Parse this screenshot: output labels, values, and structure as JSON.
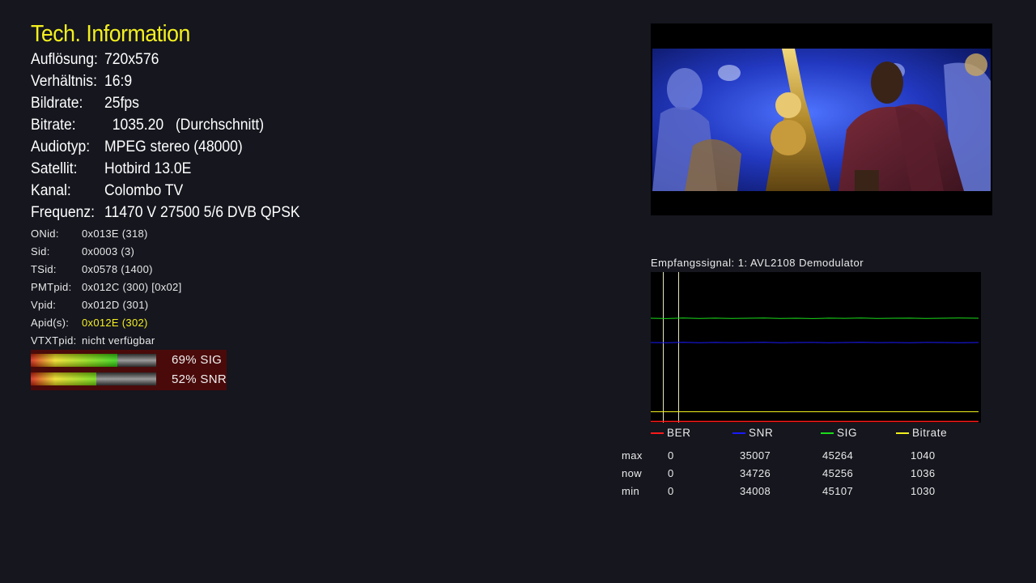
{
  "title": "Tech. Information",
  "info": [
    {
      "label": "Auflösung:",
      "value": "720x576"
    },
    {
      "label": "Verhältnis:",
      "value": "16:9"
    },
    {
      "label": "Bildrate:",
      "value": "25fps"
    },
    {
      "label": "Bitrate:",
      "value": "  1035.20   (Durchschnitt)"
    },
    {
      "label": "Audiotyp:",
      "value": "MPEG stereo (48000)"
    },
    {
      "label": "Satellit:",
      "value": "Hotbird 13.0E"
    },
    {
      "label": "Kanal:",
      "value": "Colombo TV"
    },
    {
      "label": "Frequenz:",
      "value": "11470 V 27500 5/6 DVB QPSK"
    }
  ],
  "pids": [
    {
      "label": "ONid:",
      "value": "0x013E (318)"
    },
    {
      "label": "Sid:",
      "value": "0x0003 (3)"
    },
    {
      "label": "TSid:",
      "value": "0x0578 (1400)"
    },
    {
      "label": "PMTpid:",
      "value": "0x012C (300) [0x02]"
    },
    {
      "label": "Vpid:",
      "value": "0x012D (301)"
    },
    {
      "label": "Apid(s):",
      "value": "0x012E (302)"
    },
    {
      "label": "VTXTpid:",
      "value": "nicht verfügbar"
    }
  ],
  "meters": [
    {
      "label": "69% SIG",
      "percent": 69
    },
    {
      "label": "52% SNR",
      "percent": 52
    }
  ],
  "signal": {
    "title": "Empfangssignal: 1: AVL2108 Demodulator",
    "legend": [
      {
        "name": "BER",
        "color": "#ff1a1a"
      },
      {
        "name": "SNR",
        "color": "#1a1aff"
      },
      {
        "name": "SIG",
        "color": "#1adc1a"
      },
      {
        "name": "Bitrate",
        "color": "#f0f01e"
      }
    ],
    "stats": [
      {
        "label": "max",
        "ber": "0",
        "snr": "35007",
        "sig": "45264",
        "bitrate": "1040"
      },
      {
        "label": "now",
        "ber": "0",
        "snr": "34726",
        "sig": "45256",
        "bitrate": "1036"
      },
      {
        "label": "min",
        "ber": "0",
        "snr": "34008",
        "sig": "45107",
        "bitrate": "1030"
      }
    ]
  },
  "colors": {
    "accent": "#f4f01e",
    "background": "#15161e",
    "meter_bg": "#4a0a0a"
  }
}
